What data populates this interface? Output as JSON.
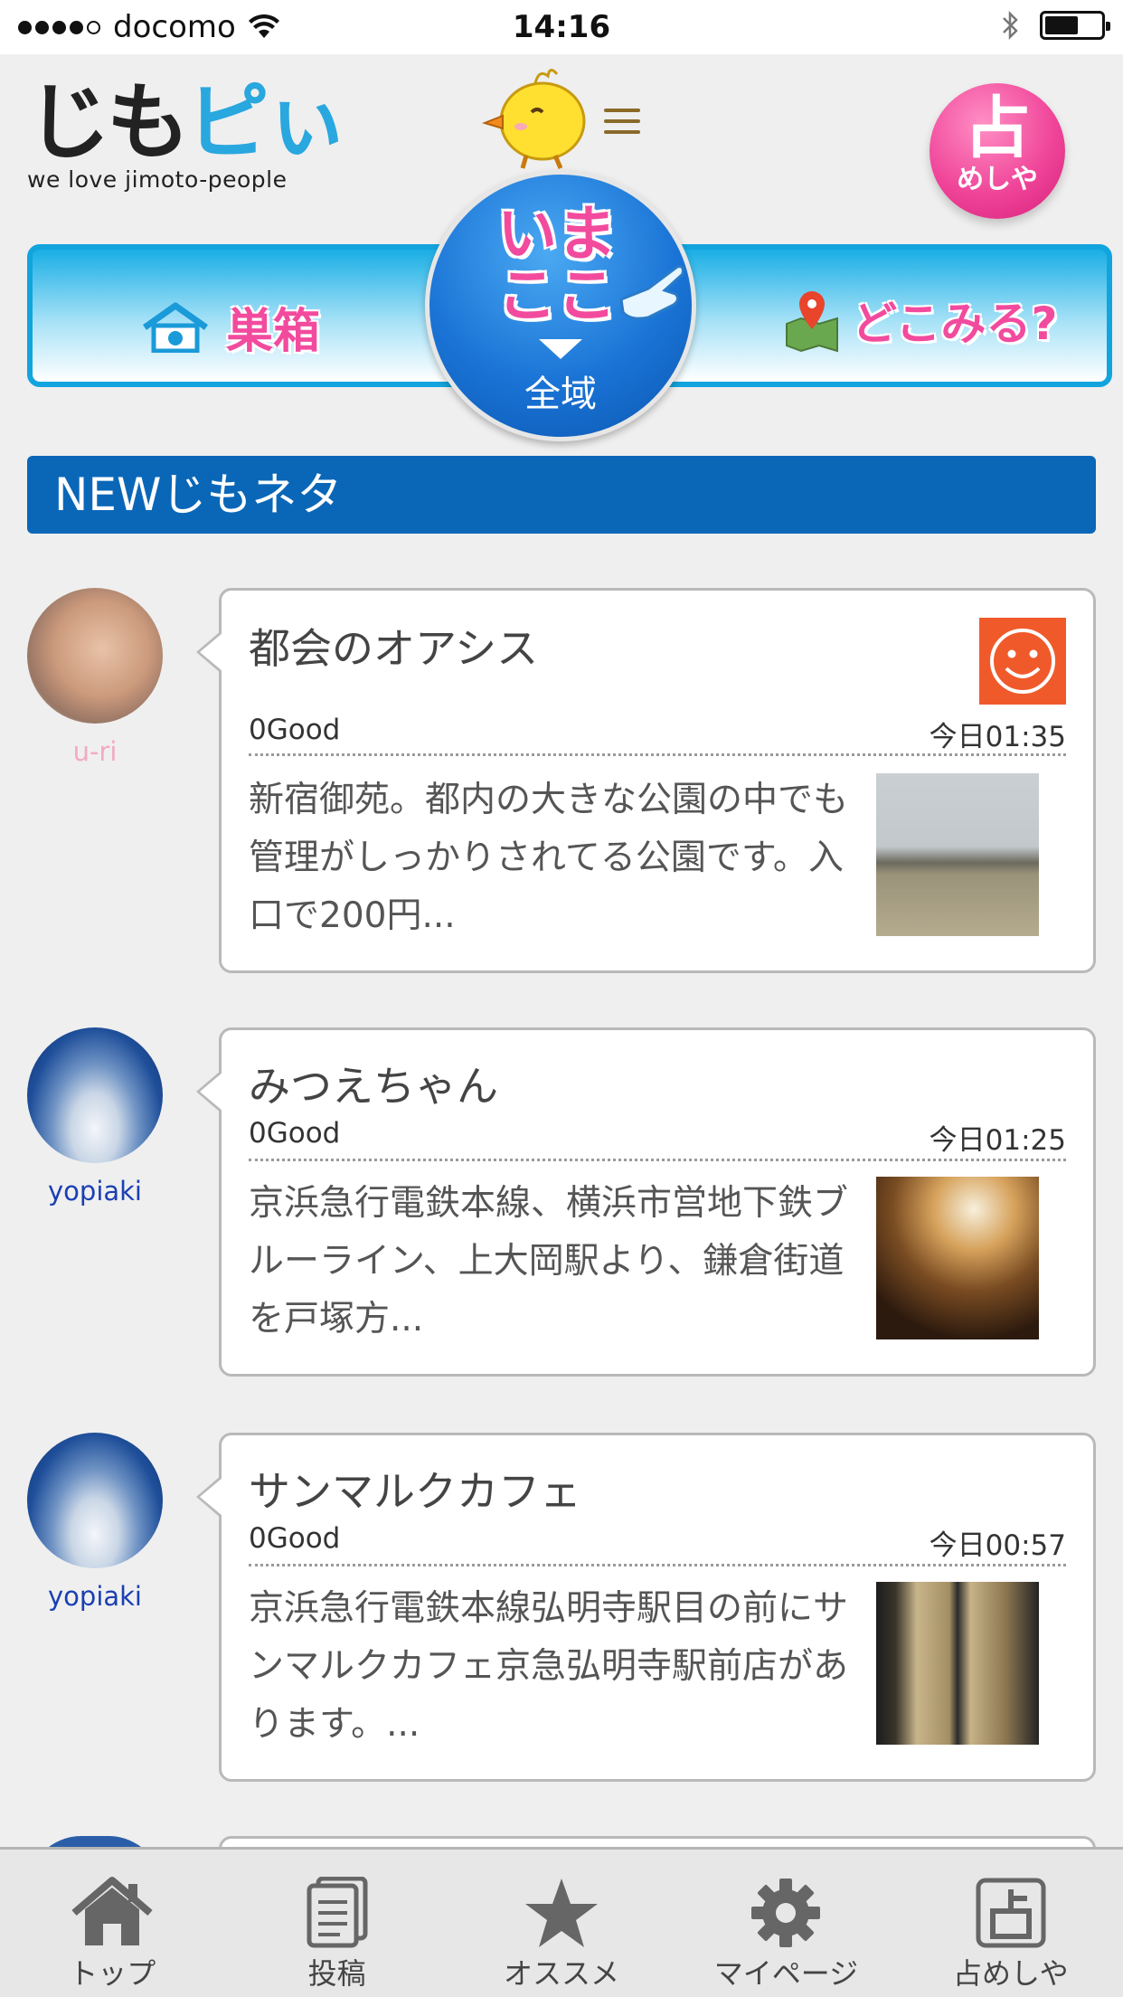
{
  "status_bar": {
    "carrier": "docomo",
    "time": "14:16"
  },
  "header": {
    "logo_text_1": "じも",
    "logo_text_2": "ピぃ",
    "logo_tagline": "we love jimoto-people",
    "fortune_big": "占",
    "fortune_small": "めしや"
  },
  "nav": {
    "left_label": "巣箱",
    "center_text": "いまここ",
    "area_label": "全域",
    "right_label": "どこみる?"
  },
  "section": {
    "title": "NEWじもネタ"
  },
  "posts": [
    {
      "username": "u-ri",
      "title": "都会のオアシス",
      "good": "0Good",
      "time": "今日01:35",
      "body": "新宿御苑。都内の大きな公園の中でも管理がしっかりされてる公園です。入口で200円..."
    },
    {
      "username": "yopiaki",
      "title": "みつえちゃん",
      "good": "0Good",
      "time": "今日01:25",
      "body": "京浜急行電鉄本線、横浜市営地下鉄ブルーライン、上大岡駅より、鎌倉街道を戸塚方..."
    },
    {
      "username": "yopiaki",
      "title": "サンマルクカフェ",
      "good": "0Good",
      "time": "今日00:57",
      "body": "京浜急行電鉄本線弘明寺駅目の前にサンマルクカフェ京急弘明寺駅前店があります。..."
    }
  ],
  "tabbar": [
    {
      "label": "トップ",
      "icon": "home-icon"
    },
    {
      "label": "投稿",
      "icon": "document-icon"
    },
    {
      "label": "オススメ",
      "icon": "star-icon"
    },
    {
      "label": "マイページ",
      "icon": "gear-icon"
    },
    {
      "label": "占めしや",
      "icon": "fortune-icon"
    }
  ],
  "colors": {
    "brand_blue": "#0a67b8",
    "accent_pink": "#f24b9e",
    "sky_blue": "#12a4de",
    "smile_orange": "#f05a2b"
  }
}
